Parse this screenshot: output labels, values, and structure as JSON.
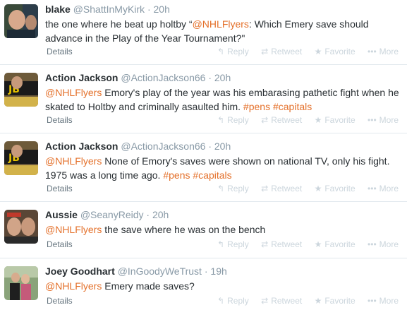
{
  "tweets": [
    {
      "name": "blake",
      "handle": "@ShattInMyKirk",
      "time": "20h",
      "text_parts": [
        {
          "t": "the one where he beat up holtby “",
          "k": "plain"
        },
        {
          "t": "@NHLFlyers",
          "k": "mention"
        },
        {
          "t": ": Which Emery save should advance in the Play of the Year Tournament?\"",
          "k": "plain"
        }
      ],
      "details": "Details",
      "actions": {
        "reply": "Reply",
        "retweet": "Retweet",
        "favorite": "Favorite",
        "more": "More"
      }
    },
    {
      "name": "Action Jackson",
      "handle": "@ActionJackson66",
      "time": "20h",
      "text_parts": [
        {
          "t": "@NHLFlyers",
          "k": "mention"
        },
        {
          "t": " Emory's play of the year was his embarasing pathetic fight when he skated to Holtby and criminally asaulted him. ",
          "k": "plain"
        },
        {
          "t": "#pens",
          "k": "hashtag"
        },
        {
          "t": " ",
          "k": "plain"
        },
        {
          "t": "#capitals",
          "k": "hashtag"
        }
      ],
      "details": "Details",
      "actions": {
        "reply": "Reply",
        "retweet": "Retweet",
        "favorite": "Favorite",
        "more": "More"
      }
    },
    {
      "name": "Action Jackson",
      "handle": "@ActionJackson66",
      "time": "20h",
      "text_parts": [
        {
          "t": "@NHLFlyers",
          "k": "mention"
        },
        {
          "t": " None of Emory's saves were shown on national TV, only his fight. 1975 was a long time ago. ",
          "k": "plain"
        },
        {
          "t": "#pens",
          "k": "hashtag"
        },
        {
          "t": " ",
          "k": "plain"
        },
        {
          "t": "#capitals",
          "k": "hashtag"
        }
      ],
      "details": "Details",
      "actions": {
        "reply": "Reply",
        "retweet": "Retweet",
        "favorite": "Favorite",
        "more": "More"
      }
    },
    {
      "name": "Aussie",
      "handle": "@SeanyReidy",
      "time": "20h",
      "text_parts": [
        {
          "t": "@NHLFlyers",
          "k": "mention"
        },
        {
          "t": " the save where he was on the bench",
          "k": "plain"
        }
      ],
      "details": "Details",
      "actions": {
        "reply": "Reply",
        "retweet": "Retweet",
        "favorite": "Favorite",
        "more": "More"
      }
    },
    {
      "name": "Joey Goodhart",
      "handle": "@InGoodyWeTrust",
      "time": "19h",
      "text_parts": [
        {
          "t": "@NHLFlyers",
          "k": "mention"
        },
        {
          "t": " Emery made saves?",
          "k": "plain"
        }
      ],
      "details": "Details",
      "actions": {
        "reply": "Reply",
        "retweet": "Retweet",
        "favorite": "Favorite",
        "more": "More"
      }
    }
  ],
  "colors": {
    "link": "#e4702a",
    "muted": "#8899a6",
    "action": "#ccd6dd",
    "divider": "#e1e8ed"
  },
  "icons": {
    "reply": "reply-icon",
    "retweet": "retweet-icon",
    "favorite": "star-icon",
    "more": "more-dots-icon"
  }
}
